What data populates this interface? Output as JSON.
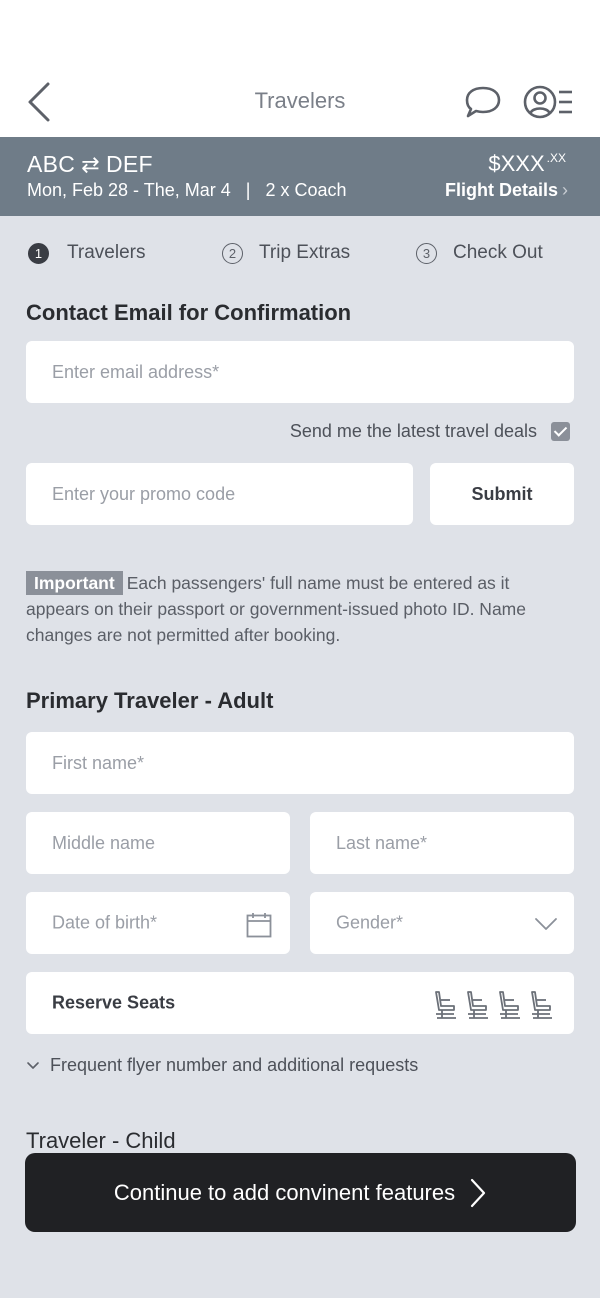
{
  "header": {
    "title": "Travelers",
    "icons": {
      "back": "back-chevron-icon",
      "chat": "chat-bubble-icon",
      "profile": "profile-menu-icon"
    }
  },
  "flight": {
    "origin": "ABC",
    "swap_glyph": "⇄",
    "destination": "DEF",
    "dates": "Mon, Feb 28 - The, Mar 4   |   2 x Coach",
    "price": "$XXX",
    "price_cents": ".XX",
    "details_label": "Flight Details",
    "details_chevron": "›"
  },
  "steps": [
    {
      "number": "1",
      "label": "Travelers",
      "active": true
    },
    {
      "number": "2",
      "label": "Trip Extras",
      "active": false
    },
    {
      "number": "3",
      "label": "Check Out",
      "active": false
    }
  ],
  "contact": {
    "title": "Contact Email for Confirmation",
    "email_placeholder": "Enter email address*",
    "email_value": "",
    "deals_label": "Send me the latest travel deals",
    "deals_checked": true,
    "promo_placeholder": "Enter your promo code",
    "promo_value": "",
    "submit_label": "Submit"
  },
  "notice": {
    "badge": "Important",
    "text": "Each passengers' full name must be entered as it appears on their passport or government-issued photo ID. Name changes are not permitted after booking."
  },
  "primary_traveler": {
    "title": "Primary Traveler  - Adult",
    "first_name_placeholder": "First name*",
    "middle_name_placeholder": "Middle name",
    "last_name_placeholder": "Last name*",
    "dob_placeholder": "Date of birth*",
    "gender_placeholder": "Gender*",
    "reserve_seats_label": "Reserve Seats",
    "seat_count": 4,
    "frequent_flyer_label": "Frequent flyer number and additional requests"
  },
  "child_traveler": {
    "title": "Traveler - Child"
  },
  "cta": {
    "label": "Continue to add convinent features"
  },
  "colors": {
    "header_bar": "#6f7c88",
    "background": "#dfe2e8",
    "cta": "#202124"
  }
}
